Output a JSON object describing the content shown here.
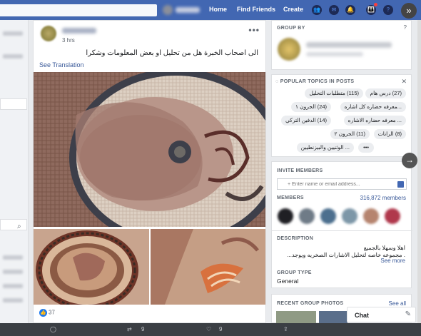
{
  "topbar": {
    "nav": [
      "Home",
      "Find Friends",
      "Create"
    ],
    "icons": [
      "friends-icon",
      "messenger-icon",
      "notifications-icon",
      "groups-icon",
      "help-icon"
    ],
    "expand_icon": "double-chevron-right-icon"
  },
  "post": {
    "time": "3 hrs",
    "menu": "•••",
    "message": "الى اصحاب الخبرة هل من تحليل او بعض المعلومات وشكرا",
    "see_translation": "See Translation",
    "likes_count": "37"
  },
  "sidebar": {
    "group_by": {
      "title": "GROUP BY"
    },
    "popular_topics": {
      "title": "POPULAR TOPICS IN POSTS",
      "topics": [
        "(27) درس هام",
        "(115) متطلبات التحليل",
        "(24) الجرون ١",
        "...معرفه حضاره كل اشاره",
        "(14) الدفين التركي",
        "... معرفه حضاره الاشاره",
        "(8) الرانات",
        "(11) الجرون ٢",
        "... الوثنيين والبيزنطيين",
        "•••"
      ]
    },
    "invite": {
      "title": "INVITE MEMBERS",
      "placeholder": "+ Enter name or email address..."
    },
    "members": {
      "title": "MEMBERS",
      "count": "316,872 members"
    },
    "description": {
      "title": "DESCRIPTION",
      "line1": "اهلا وسهلا بالجميع",
      "line2": ". مجموعه خاصه لتحليل الاشارات الصخريه ويوجد...",
      "see_more": "See more"
    },
    "group_type": {
      "title": "GROUP TYPE",
      "value": "General"
    },
    "recent_photos": {
      "title": "RECENT GROUP PHOTOS",
      "see_all": "See all"
    }
  },
  "chat": {
    "label": "Chat"
  },
  "bottombar": {
    "retweets": "9",
    "likes": "9"
  },
  "colors": {
    "facebook_blue": "#4267b2",
    "link_blue": "#385898",
    "like_blue": "#1877f2",
    "bottom_bar": "#3b3f44"
  }
}
